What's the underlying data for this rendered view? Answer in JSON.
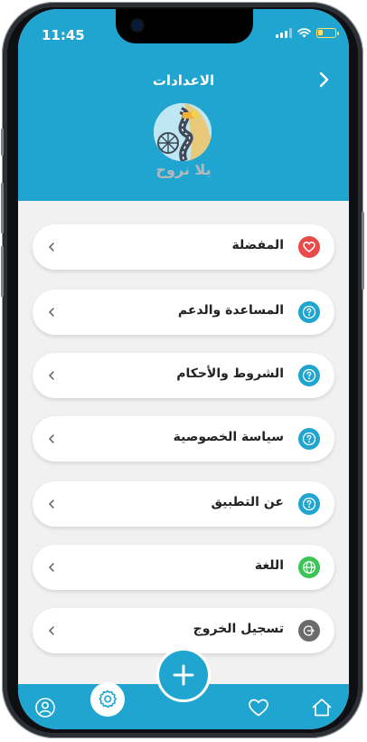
{
  "status": {
    "time": "11:45"
  },
  "header": {
    "title": "الاعدادات",
    "logo_text": "يلا نروح"
  },
  "menu": [
    {
      "label": "المفضلة",
      "icon": "heart-icon",
      "color": "#e94b4b"
    },
    {
      "label": "المساعدة والدعم",
      "icon": "help-icon",
      "color": "#1fa5cf"
    },
    {
      "label": "الشروط والأحكام",
      "icon": "help-icon",
      "color": "#1fa5cf"
    },
    {
      "label": "سياسة الخصوصية",
      "icon": "help-icon",
      "color": "#1fa5cf"
    },
    {
      "label": "عن التطبيق",
      "icon": "help-icon",
      "color": "#1fa5cf"
    },
    {
      "label": "اللغة",
      "icon": "globe-icon",
      "color": "#3cc457"
    },
    {
      "label": "تسجيل الخروج",
      "icon": "logout-icon",
      "color": "#6b6b6b"
    }
  ],
  "colors": {
    "accent": "#1fa5cf",
    "background": "#f1f1f1"
  },
  "bottom_nav": {
    "items": [
      "home-icon",
      "heart-icon",
      "add-icon",
      "settings-icon",
      "profile-icon"
    ],
    "active": "settings-icon"
  }
}
